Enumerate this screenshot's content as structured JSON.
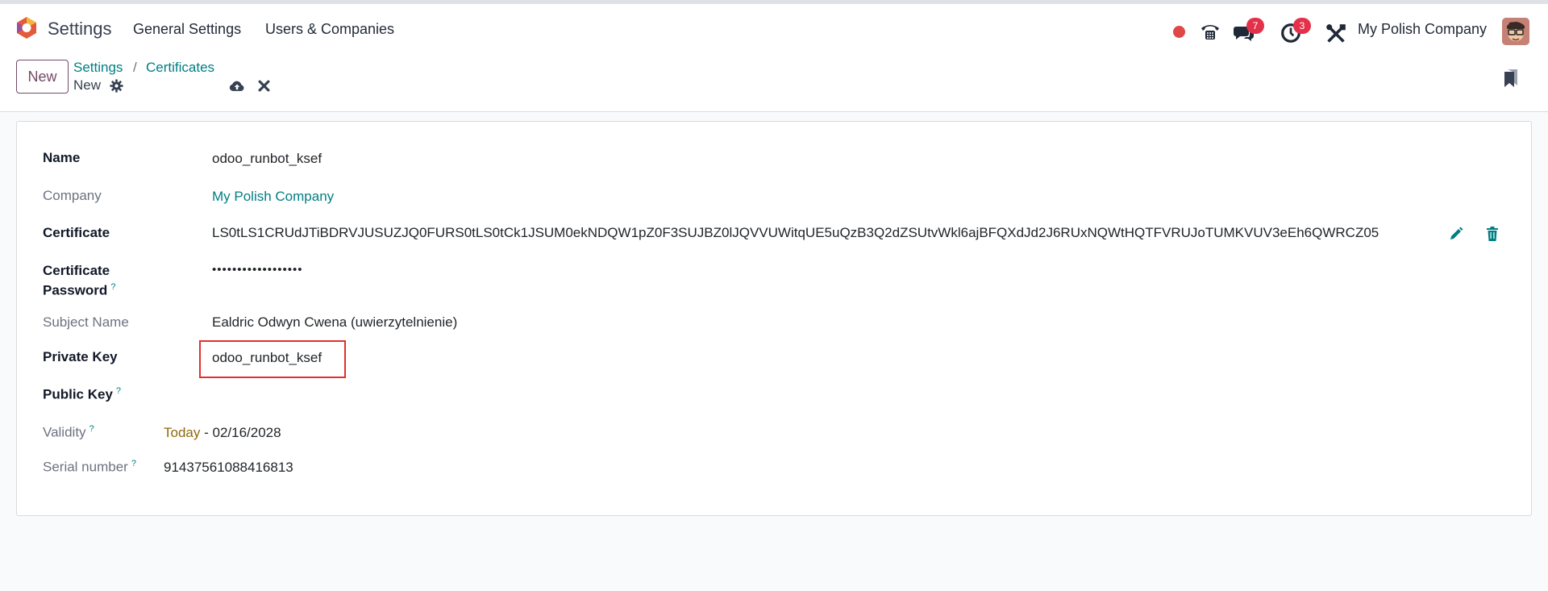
{
  "navbar": {
    "app_title": "Settings",
    "menu": [
      "General Settings",
      "Users & Companies"
    ],
    "messages_count": "7",
    "activities_count": "3",
    "company": "My Polish Company"
  },
  "control_panel": {
    "new_button": "New",
    "breadcrumb": [
      "Settings",
      "Certificates"
    ],
    "breadcrumb_separator": "/",
    "record_name": "New"
  },
  "form": {
    "fields": {
      "name": {
        "label": "Name",
        "value": "odoo_runbot_ksef"
      },
      "company": {
        "label": "Company",
        "value": "My Polish Company"
      },
      "certificate": {
        "label": "Certificate",
        "value": "LS0tLS1CRUdJTiBDRVJUSUZJQ0FURS0tLS0tCk1JSUM0ekNDQW1pZ0F3SUJBZ0lJQVVUWitqUE5uQzB3Q2dZSUtvWkl6ajBFQXdJd2J6RUxNQWtHQTFVRUJoTUMKVUV3eEh6QWRCZ05"
      },
      "certificate_password": {
        "label_line1": "Certificate",
        "label_line2": "Password",
        "value": "••••••••••••••••••"
      },
      "subject_name": {
        "label": "Subject Name",
        "value": "Ealdric Odwyn Cwena (uwierzytelnienie)"
      },
      "private_key": {
        "label": "Private Key",
        "value": "odoo_runbot_ksef"
      },
      "public_key": {
        "label": "Public Key",
        "value": ""
      },
      "validity": {
        "label": "Validity",
        "start": "Today",
        "separator": " - ",
        "end": "02/16/2028"
      },
      "serial_number": {
        "label": "Serial number",
        "value": "91437561088416813"
      }
    },
    "help_marker": "?"
  },
  "colors": {
    "brand": "#714b67",
    "link": "#017e84",
    "badge": "#e3314a",
    "highlight_border": "#e0312c"
  },
  "icons": [
    "odoo-logo-icon",
    "phone-icon",
    "messages-icon",
    "activity-clock-icon",
    "tools-icon",
    "gear-icon",
    "cloud-upload-icon",
    "close-icon",
    "bookmark-icon",
    "pencil-icon",
    "trash-icon"
  ]
}
